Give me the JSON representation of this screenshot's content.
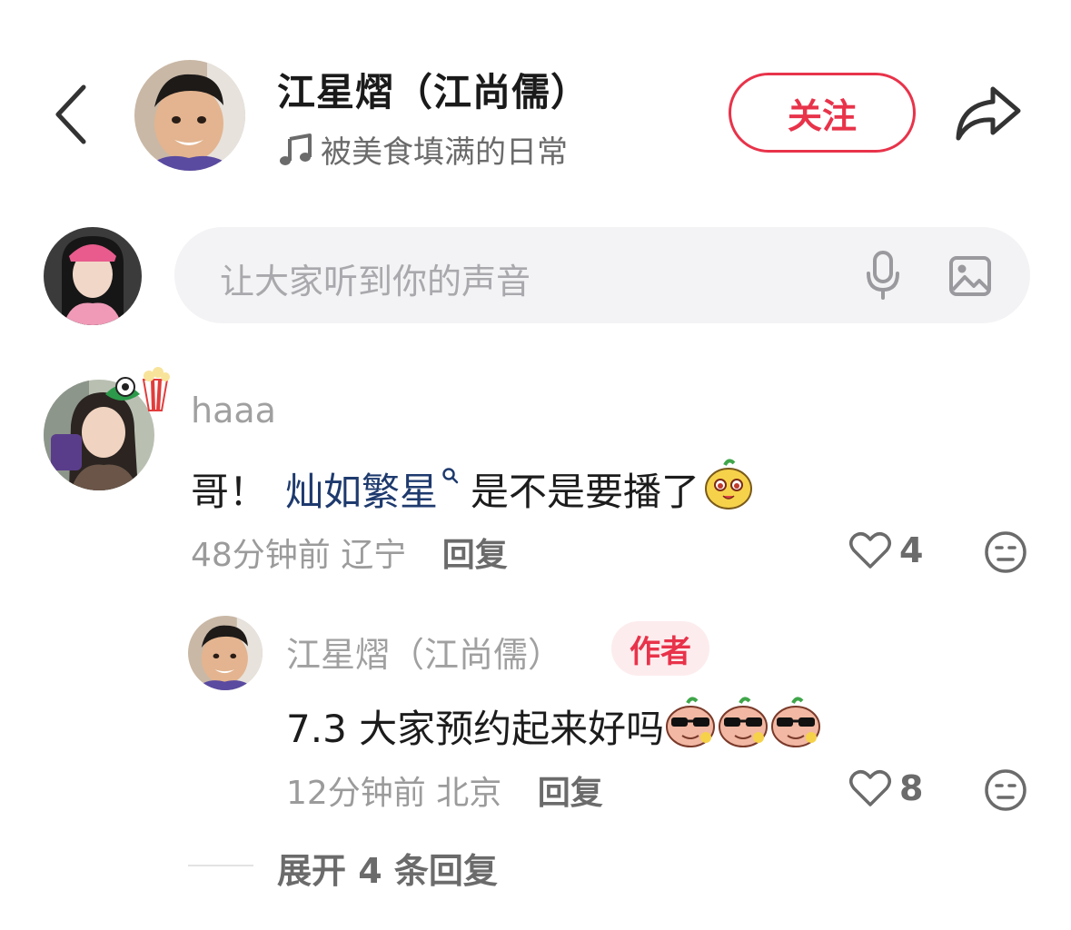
{
  "header": {
    "title": "江星熠（江尚儒）",
    "subtitle": "被美食填满的日常",
    "follow_label": "关注",
    "icons": {
      "back": "chevron-left-icon",
      "share": "share-arrow-icon",
      "music": "music-note-icon"
    }
  },
  "composer": {
    "placeholder": "让大家听到你的声音",
    "icons": {
      "mic": "microphone-icon",
      "image": "image-icon"
    }
  },
  "comments": [
    {
      "username": "haaa",
      "text_prefix": "哥！",
      "mention": "灿如繁星",
      "text_suffix": "是不是要播了",
      "time_location": "48分钟前 辽宁",
      "reply_label": "回复",
      "likes": "4",
      "replies": [
        {
          "username": "江星熠（江尚儒）",
          "tag": "作者",
          "text": "7.3 大家预约起来好吗",
          "time_location": "12分钟前 北京",
          "reply_label": "回复",
          "likes": "8"
        }
      ],
      "expand_label": "展开 4 条回复"
    }
  ],
  "colors": {
    "accent": "#e8334a",
    "mention": "#1e3a6e",
    "muted": "#9b9b9b",
    "input_bg": "#f3f3f5"
  }
}
